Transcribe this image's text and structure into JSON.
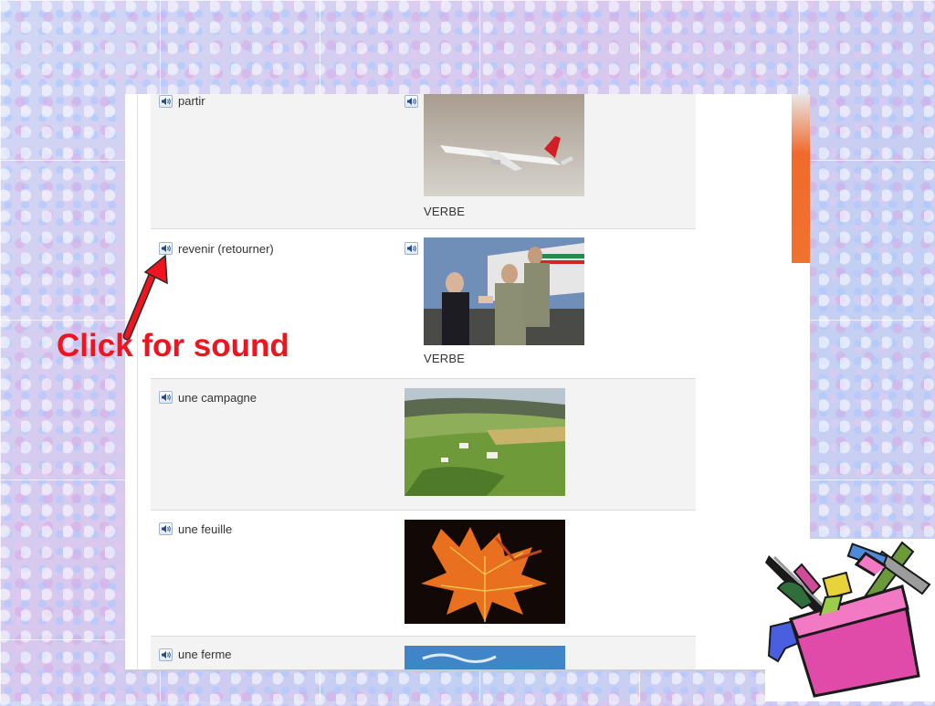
{
  "vocab": [
    {
      "word": "partir",
      "tag": "VERBE"
    },
    {
      "word": "revenir (retourner)",
      "tag": "VERBE"
    },
    {
      "word": "une campagne",
      "tag": ""
    },
    {
      "word": "une feuille",
      "tag": ""
    },
    {
      "word": "une ferme",
      "tag": ""
    }
  ],
  "callout": {
    "text": "Click for sound"
  },
  "colors": {
    "accent_red": "#f0141e",
    "panel_orange": "#f06a2c",
    "row_grey": "#f3f3f3"
  },
  "icons": [
    "speaker-icon",
    "arrow-pointer-icon",
    "toolbox-clipart-icon"
  ]
}
